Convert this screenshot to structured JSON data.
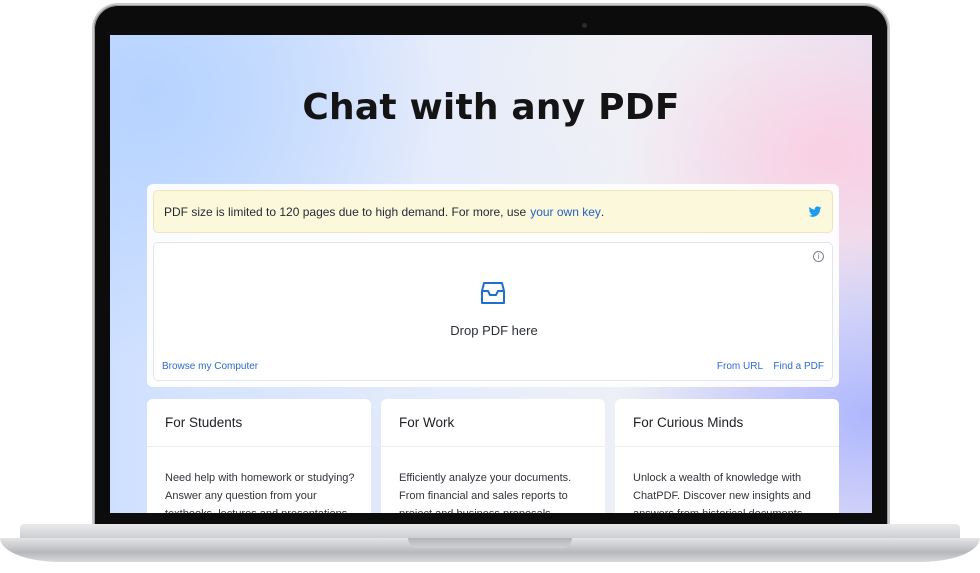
{
  "hero": {
    "title": "Chat with any PDF"
  },
  "notice": {
    "text": "PDF size is limited to 120 pages due to high demand. For more, use",
    "link": "your own key",
    "trailing": "."
  },
  "dropzone": {
    "label": "Drop PDF here",
    "browse": "Browse my Computer",
    "from_url": "From URL",
    "find_pdf": "Find a PDF",
    "info_glyph": "i"
  },
  "cards": [
    {
      "title": "For Students",
      "body": "Need help with homework or studying? Answer any question from your textbooks, lectures and presentations."
    },
    {
      "title": "For Work",
      "body": "Efficiently analyze your documents. From financial and sales reports to project and business proposals, training manuals."
    },
    {
      "title": "For Curious Minds",
      "body": "Unlock a wealth of knowledge with ChatPDF. Discover new insights and answers from historical documents."
    }
  ],
  "icons": {
    "twitter": "twitter-icon",
    "inbox": "inbox-icon",
    "info": "info-icon"
  },
  "colors": {
    "link": "#2563c9",
    "banner": "#fcf8dc",
    "twitter": "#1d9bf0"
  }
}
